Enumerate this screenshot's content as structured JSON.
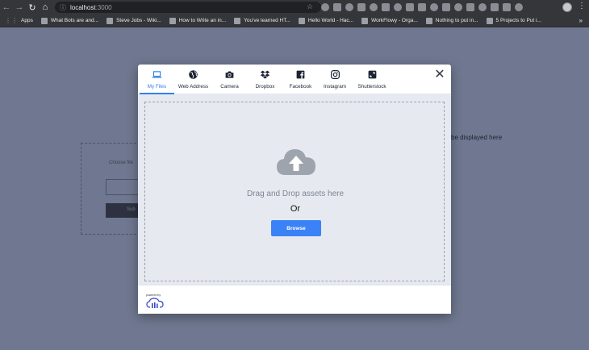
{
  "browser": {
    "url_host": "localhost",
    "url_port": ":3000",
    "bookmarks": [
      {
        "label": "Apps"
      },
      {
        "label": "What Bots are and..."
      },
      {
        "label": "Steve Jobs - Wiki..."
      },
      {
        "label": "How to Write an in..."
      },
      {
        "label": "You've learned HT..."
      },
      {
        "label": "Hello World - Hac..."
      },
      {
        "label": "WorkFlowy - Orga..."
      },
      {
        "label": "Nothing to put in..."
      },
      {
        "label": "5 Projects to Put i..."
      }
    ],
    "more_bookmarks": "»"
  },
  "background": {
    "choose_label": "Choose file",
    "button_label": "Sub",
    "side_text": "be displayed here"
  },
  "modal": {
    "tabs": [
      {
        "label": "My Files",
        "icon": "laptop-icon"
      },
      {
        "label": "Web Address",
        "icon": "globe-icon"
      },
      {
        "label": "Camera",
        "icon": "camera-icon"
      },
      {
        "label": "Dropbox",
        "icon": "dropbox-icon"
      },
      {
        "label": "Facebook",
        "icon": "facebook-icon"
      },
      {
        "label": "Instagram",
        "icon": "instagram-icon"
      },
      {
        "label": "Shutterstock",
        "icon": "shutterstock-icon"
      }
    ],
    "active_tab": "My Files",
    "close_label": "✕",
    "drag_text": "Drag and Drop assets here",
    "or_text": "Or",
    "browse_label": "Browse",
    "powered_by": "powered by",
    "accent_color": "#3b82f6"
  }
}
